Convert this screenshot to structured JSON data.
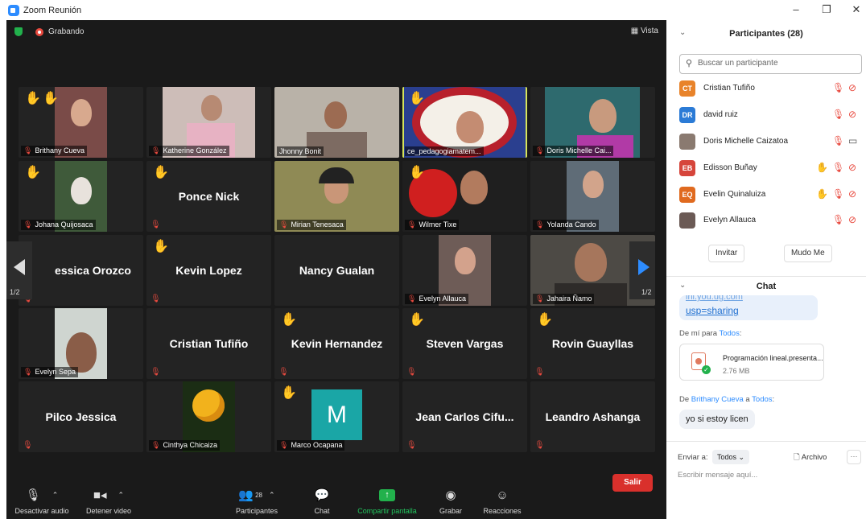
{
  "window": {
    "title": "Zoom Reunión"
  },
  "topbar": {
    "recording": "Grabando",
    "view": "Vista"
  },
  "grid": {
    "page": "1/2",
    "tiles": [
      {
        "label": "Brithany Cueva"
      },
      {
        "label": "Katherine González"
      },
      {
        "label": "Jhonny Bonit"
      },
      {
        "label": "ce_pedagogiamatem..."
      },
      {
        "label": "Doris Michelle Cai..."
      },
      {
        "label": "Johana Quijosaca"
      },
      {
        "name": "Ponce Nick"
      },
      {
        "label": "Mirian Tenesaca"
      },
      {
        "label": "Wilmer Tixe"
      },
      {
        "label": "Yolanda Cando"
      },
      {
        "name": "essica Orozco"
      },
      {
        "name": "Kevin Lopez"
      },
      {
        "name": "Nancy Gualan"
      },
      {
        "label": "Evelyn Allauca"
      },
      {
        "label": "Jahaira Ñamo"
      },
      {
        "label": "Evelyn Sepa"
      },
      {
        "name": "Cristian Tufiño"
      },
      {
        "name": "Kevin Hernandez"
      },
      {
        "name": "Steven Vargas"
      },
      {
        "name": "Rovin Guayllas"
      },
      {
        "name": "Pilco Jessica"
      },
      {
        "label": "Cinthya Chicaiza"
      },
      {
        "label": "Marco Ocapana",
        "avatar": "M"
      },
      {
        "name": "Jean Carlos Cifu..."
      },
      {
        "name": "Leandro Ashanga"
      }
    ]
  },
  "toolbar": {
    "mute": "Desactivar audio",
    "video": "Detener video",
    "participants": "Participantes",
    "participants_count": "28",
    "chat": "Chat",
    "share": "Compartir pantalla",
    "record": "Grabar",
    "reactions": "Reacciones",
    "leave": "Salir"
  },
  "participants_panel": {
    "title": "Participantes (28)",
    "search_placeholder": "Buscar un participante",
    "list": [
      {
        "initials": "CT",
        "name": "Cristian Tufiño",
        "color": "#e8832a"
      },
      {
        "initials": "DR",
        "name": "david ruiz",
        "color": "#2b7bd6"
      },
      {
        "initials": "",
        "name": "Doris Michelle Caizatoa",
        "color": "#8a7a70"
      },
      {
        "initials": "EB",
        "name": "Edisson Buñay",
        "color": "#d6453b"
      },
      {
        "initials": "EQ",
        "name": "Evelin Quinaluiza",
        "color": "#e06a1f"
      },
      {
        "initials": "",
        "name": "Evelyn Allauca",
        "color": "#6b5a55"
      }
    ],
    "invite": "Invitar",
    "mute_me": "Mudo Me"
  },
  "chat_panel": {
    "title": "Chat",
    "link_partial": "ini.you.ug.com",
    "link_text": "usp=sharing",
    "from_me": "De mí para",
    "to_all": "Todos",
    "file_name": "Programación lineal.presenta...",
    "file_size": "2.76 MB",
    "from_prefix": "De",
    "sender": "Brithany Cueva",
    "to_word": "a",
    "message": "yo si estoy licen",
    "send_to": "Enviar a:",
    "send_target": "Todos",
    "file_button": "Archivo",
    "input_placeholder": "Escribir mensaje aquí..."
  }
}
